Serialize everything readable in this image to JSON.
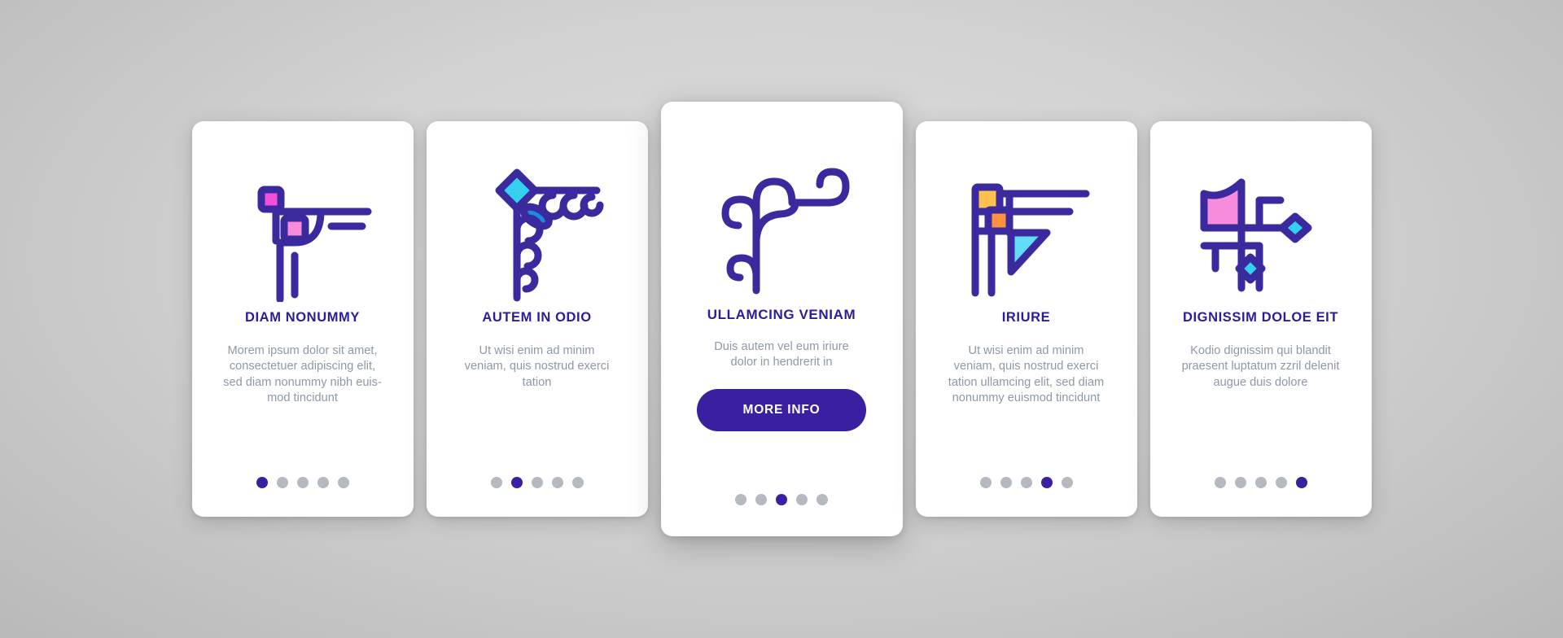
{
  "theme": {
    "accent": "#3a20a0",
    "title_color": "#2a1d9c",
    "body_color": "#8d98a8",
    "dot_inactive": "#b5b9c0",
    "card_bg": "#ffffff",
    "page_bg": "#d2d2d2",
    "icon_cyan": "#35d0f0",
    "icon_blue": "#1b8ae0",
    "icon_pink": "#f78cdc",
    "icon_magenta": "#f250d8",
    "icon_yellow": "#ffc14d",
    "icon_orange": "#ff9040"
  },
  "cards": [
    {
      "icon_name": "corner-ornament-squares-icon",
      "title": "DIAM NONUMMY",
      "body": "Morem ipsum dolor sit amet,\nconsectetuer adipiscing elit,\nsed diam nonummy nibh euis-\nmod tincidunt",
      "dots": {
        "count": 5,
        "active": 0
      },
      "cta": null
    },
    {
      "icon_name": "corner-ornament-diamond-leaf-icon",
      "title": "AUTEM IN ODIO",
      "body": "Ut wisi enim ad minim\nveniam, quis nostrud exerci\ntation",
      "dots": {
        "count": 5,
        "active": 1
      },
      "cta": null
    },
    {
      "icon_name": "corner-ornament-scroll-icon",
      "title": "ULLAMCING VENIAM",
      "body": "Duis autem vel eum iriure\ndolor in hendrerit in",
      "dots": {
        "count": 5,
        "active": 2
      },
      "cta": "MORE INFO"
    },
    {
      "icon_name": "corner-ornament-triangle-icon",
      "title": "IRIURE",
      "body": "Ut wisi enim ad minim\nveniam, quis nostrud exerci\ntation ullamcing elit, sed diam\nnonummy euismod tincidunt",
      "dots": {
        "count": 5,
        "active": 3
      },
      "cta": null
    },
    {
      "icon_name": "corner-ornament-banner-diamonds-icon",
      "title": "DIGNISSIM DOLOE EIT",
      "body": "Kodio dignissim qui blandit\npraesent luptatum zzril delenit\naugue duis dolore",
      "dots": {
        "count": 5,
        "active": 4
      },
      "cta": null
    }
  ]
}
